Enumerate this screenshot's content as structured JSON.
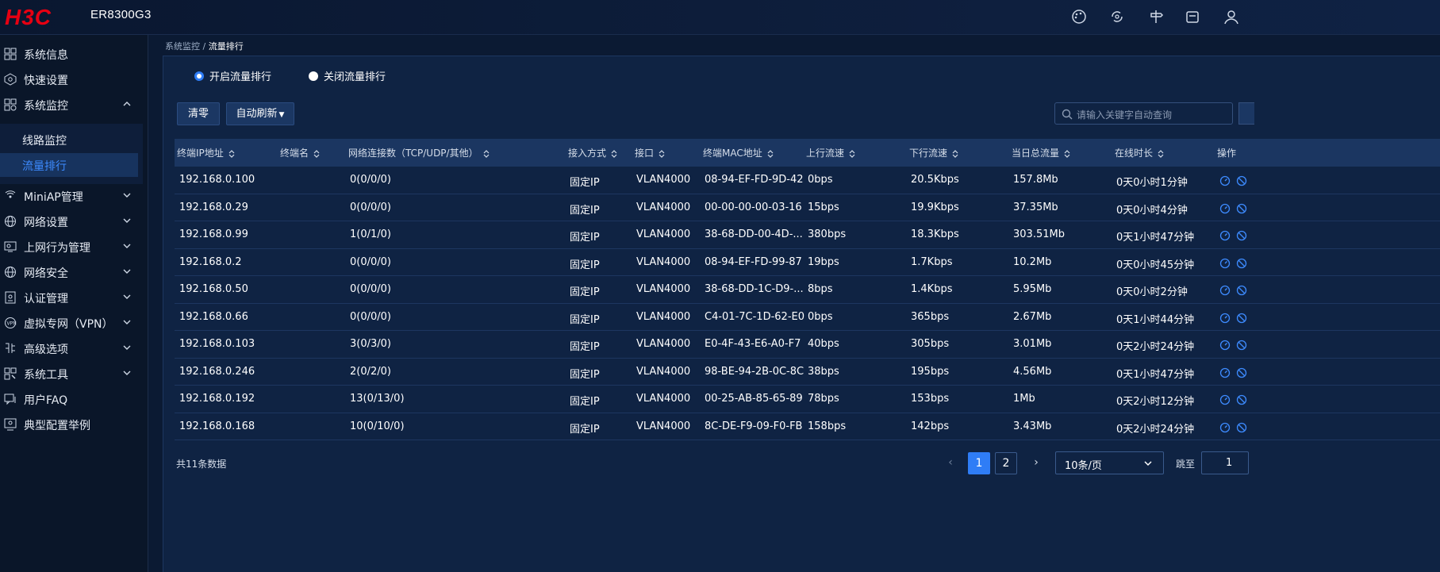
{
  "header": {
    "logo_text": "H3C",
    "model": "ER8300G3",
    "icons": [
      "palette-icon",
      "refresh-settings-icon",
      "signpost-icon",
      "mailbox-icon",
      "user-icon"
    ]
  },
  "sidebar": {
    "items": [
      {
        "label": "系统信息",
        "icon": "system-info-icon",
        "expandable": false
      },
      {
        "label": "快速设置",
        "icon": "quick-setup-icon",
        "expandable": false
      },
      {
        "label": "系统监控",
        "icon": "monitor-icon",
        "expandable": true,
        "expanded": true
      },
      {
        "label": "MiniAP管理",
        "icon": "ap-icon",
        "expandable": true
      },
      {
        "label": "网络设置",
        "icon": "globe-icon",
        "expandable": true
      },
      {
        "label": "上网行为管理",
        "icon": "behavior-icon",
        "expandable": true
      },
      {
        "label": "网络安全",
        "icon": "security-icon",
        "expandable": true
      },
      {
        "label": "认证管理",
        "icon": "auth-icon",
        "expandable": true
      },
      {
        "label": "虚拟专网（VPN）",
        "icon": "vpn-icon",
        "expandable": true
      },
      {
        "label": "高级选项",
        "icon": "advanced-icon",
        "expandable": true
      },
      {
        "label": "系统工具",
        "icon": "tools-icon",
        "expandable": true
      },
      {
        "label": "用户FAQ",
        "icon": "faq-icon",
        "expandable": false
      },
      {
        "label": "典型配置举例",
        "icon": "example-icon",
        "expandable": false
      }
    ],
    "submenu": [
      {
        "label": "线路监控",
        "active": false
      },
      {
        "label": "流量排行",
        "active": true
      }
    ]
  },
  "breadcrumb": {
    "parent": "系统监控",
    "separator": " / ",
    "current": "流量排行"
  },
  "radios": {
    "enable": {
      "label": "开启流量排行",
      "checked": true
    },
    "disable": {
      "label": "关闭流量排行",
      "checked": false
    }
  },
  "toolbar": {
    "clear_label": "清零",
    "auto_refresh_label": "自动刷新",
    "search_placeholder": "请输入关键字自动查询"
  },
  "table": {
    "columns": [
      "终端IP地址",
      "终端名",
      "网络连接数（TCP/UDP/其他）",
      "接入方式",
      "接口",
      "终端MAC地址",
      "上行流速",
      "下行流速",
      "当日总流量",
      "在线时长",
      "操作"
    ],
    "rows": [
      [
        "192.168.0.100",
        "",
        "0(0/0/0)",
        "固定IP",
        "VLAN4000",
        "08-94-EF-FD-9D-42",
        "0bps",
        "20.5Kbps",
        "157.8Mb",
        "0天0小时1分钟"
      ],
      [
        "192.168.0.29",
        "",
        "0(0/0/0)",
        "固定IP",
        "VLAN4000",
        "00-00-00-00-03-16",
        "15bps",
        "19.9Kbps",
        "37.35Mb",
        "0天0小时4分钟"
      ],
      [
        "192.168.0.99",
        "",
        "1(0/1/0)",
        "固定IP",
        "VLAN4000",
        "38-68-DD-00-4D-...",
        "380bps",
        "18.3Kbps",
        "303.51Mb",
        "0天1小时47分钟"
      ],
      [
        "192.168.0.2",
        "",
        "0(0/0/0)",
        "固定IP",
        "VLAN4000",
        "08-94-EF-FD-99-87",
        "19bps",
        "1.7Kbps",
        "10.2Mb",
        "0天0小时45分钟"
      ],
      [
        "192.168.0.50",
        "",
        "0(0/0/0)",
        "固定IP",
        "VLAN4000",
        "38-68-DD-1C-D9-...",
        "8bps",
        "1.4Kbps",
        "5.95Mb",
        "0天0小时2分钟"
      ],
      [
        "192.168.0.66",
        "",
        "0(0/0/0)",
        "固定IP",
        "VLAN4000",
        "C4-01-7C-1D-62-E0",
        "0bps",
        "365bps",
        "2.67Mb",
        "0天1小时44分钟"
      ],
      [
        "192.168.0.103",
        "",
        "3(0/3/0)",
        "固定IP",
        "VLAN4000",
        "E0-4F-43-E6-A0-F7",
        "40bps",
        "305bps",
        "3.01Mb",
        "0天2小时24分钟"
      ],
      [
        "192.168.0.246",
        "",
        "2(0/2/0)",
        "固定IP",
        "VLAN4000",
        "98-BE-94-2B-0C-8C",
        "38bps",
        "195bps",
        "4.56Mb",
        "0天1小时47分钟"
      ],
      [
        "192.168.0.192",
        "",
        "13(0/13/0)",
        "固定IP",
        "VLAN4000",
        "00-25-AB-85-65-89",
        "78bps",
        "153bps",
        "1Mb",
        "0天2小时12分钟"
      ],
      [
        "192.168.0.168",
        "",
        "10(0/10/0)",
        "固定IP",
        "VLAN4000",
        "8C-DE-F9-09-F0-FB",
        "158bps",
        "142bps",
        "3.43Mb",
        "0天2小时24分钟"
      ]
    ]
  },
  "pagination": {
    "total_label": "共11条数据",
    "pages": [
      "1",
      "2"
    ],
    "current_page": "1",
    "page_size": "10条/页",
    "jump_label": "跳至",
    "jump_value": "1"
  },
  "colors": {
    "accent": "#2f7df6",
    "bg": "#0b1a33",
    "panel": "#0f2343"
  }
}
